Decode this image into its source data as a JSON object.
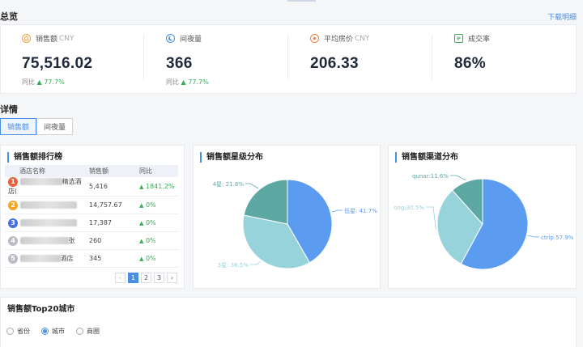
{
  "overview": {
    "title": "总览",
    "download": "下载明细"
  },
  "kpis": [
    {
      "label": "销售额",
      "unit": "CNY",
      "value": "75,516.02",
      "cmp_label": "同比",
      "cmp_value": "77.7%",
      "icon": "money-bag-icon",
      "color": "#f0a040"
    },
    {
      "label": "间夜量",
      "unit": "",
      "value": "366",
      "cmp_label": "同比",
      "cmp_value": "77.7%",
      "icon": "moon-icon",
      "color": "#4a90e2"
    },
    {
      "label": "平均房价",
      "unit": "CNY",
      "value": "206.33",
      "cmp_label": "",
      "cmp_value": "",
      "icon": "price-tag-icon",
      "color": "#f08040"
    },
    {
      "label": "成交率",
      "unit": "",
      "value": "86%",
      "cmp_label": "",
      "cmp_value": "",
      "icon": "document-icon",
      "color": "#3aae56"
    }
  ],
  "detail": {
    "title": "详情",
    "tabs": [
      "销售额",
      "间夜量"
    ]
  },
  "ranking": {
    "title": "销售额排行榜",
    "headers": [
      "酒店名称",
      "销售额",
      "同比"
    ],
    "rows": [
      {
        "rank": "1",
        "name_tail": "精选酒店(",
        "sales": "5,416",
        "yoy": "1841.2%",
        "color": "#e8613c"
      },
      {
        "rank": "2",
        "name_tail": "",
        "sales": "14,757.67",
        "yoy": "0%",
        "color": "#f5a623"
      },
      {
        "rank": "3",
        "name_tail": "",
        "sales": "17,387",
        "yoy": "0%",
        "color": "#4a6ee0"
      },
      {
        "rank": "4",
        "name_tail": "张",
        "sales": "260",
        "yoy": "0%",
        "color": "#b8bcc4"
      },
      {
        "rank": "5",
        "name_tail": "酒店",
        "sales": "345",
        "yoy": "0%",
        "color": "#b8bcc4"
      }
    ],
    "pages": [
      "1",
      "2",
      "3"
    ],
    "prev": "‹",
    "next": "›"
  },
  "star_chart": {
    "chart_data": {
      "type": "pie",
      "title": "销售额星级分布",
      "slices": [
        {
          "label": "低星",
          "value": 41.7,
          "text": "低星: 41.7%",
          "color": "#5b9cf0"
        },
        {
          "label": "3星",
          "value": 36.5,
          "text": "3星: 36.5%",
          "color": "#97d3db"
        },
        {
          "label": "4星",
          "value": 21.8,
          "text": "4星: 21.8%",
          "color": "#5ea8a4"
        }
      ]
    }
  },
  "channel_chart": {
    "chart_data": {
      "type": "pie",
      "title": "销售额渠道分布",
      "slices": [
        {
          "label": "ctrip",
          "value": 57.9,
          "text": "ctrip:57.9%",
          "color": "#5b9cf0"
        },
        {
          "label": "ong",
          "value": 30.5,
          "text": "ong:30.5%",
          "color": "#97d3db"
        },
        {
          "label": "qunar",
          "value": 11.6,
          "text": "qunar:11.6%",
          "color": "#5ea8a4"
        }
      ]
    }
  },
  "top20": {
    "title": "销售额Top20城市",
    "options": [
      "省份",
      "城市",
      "商圈"
    ],
    "selected": "城市"
  }
}
